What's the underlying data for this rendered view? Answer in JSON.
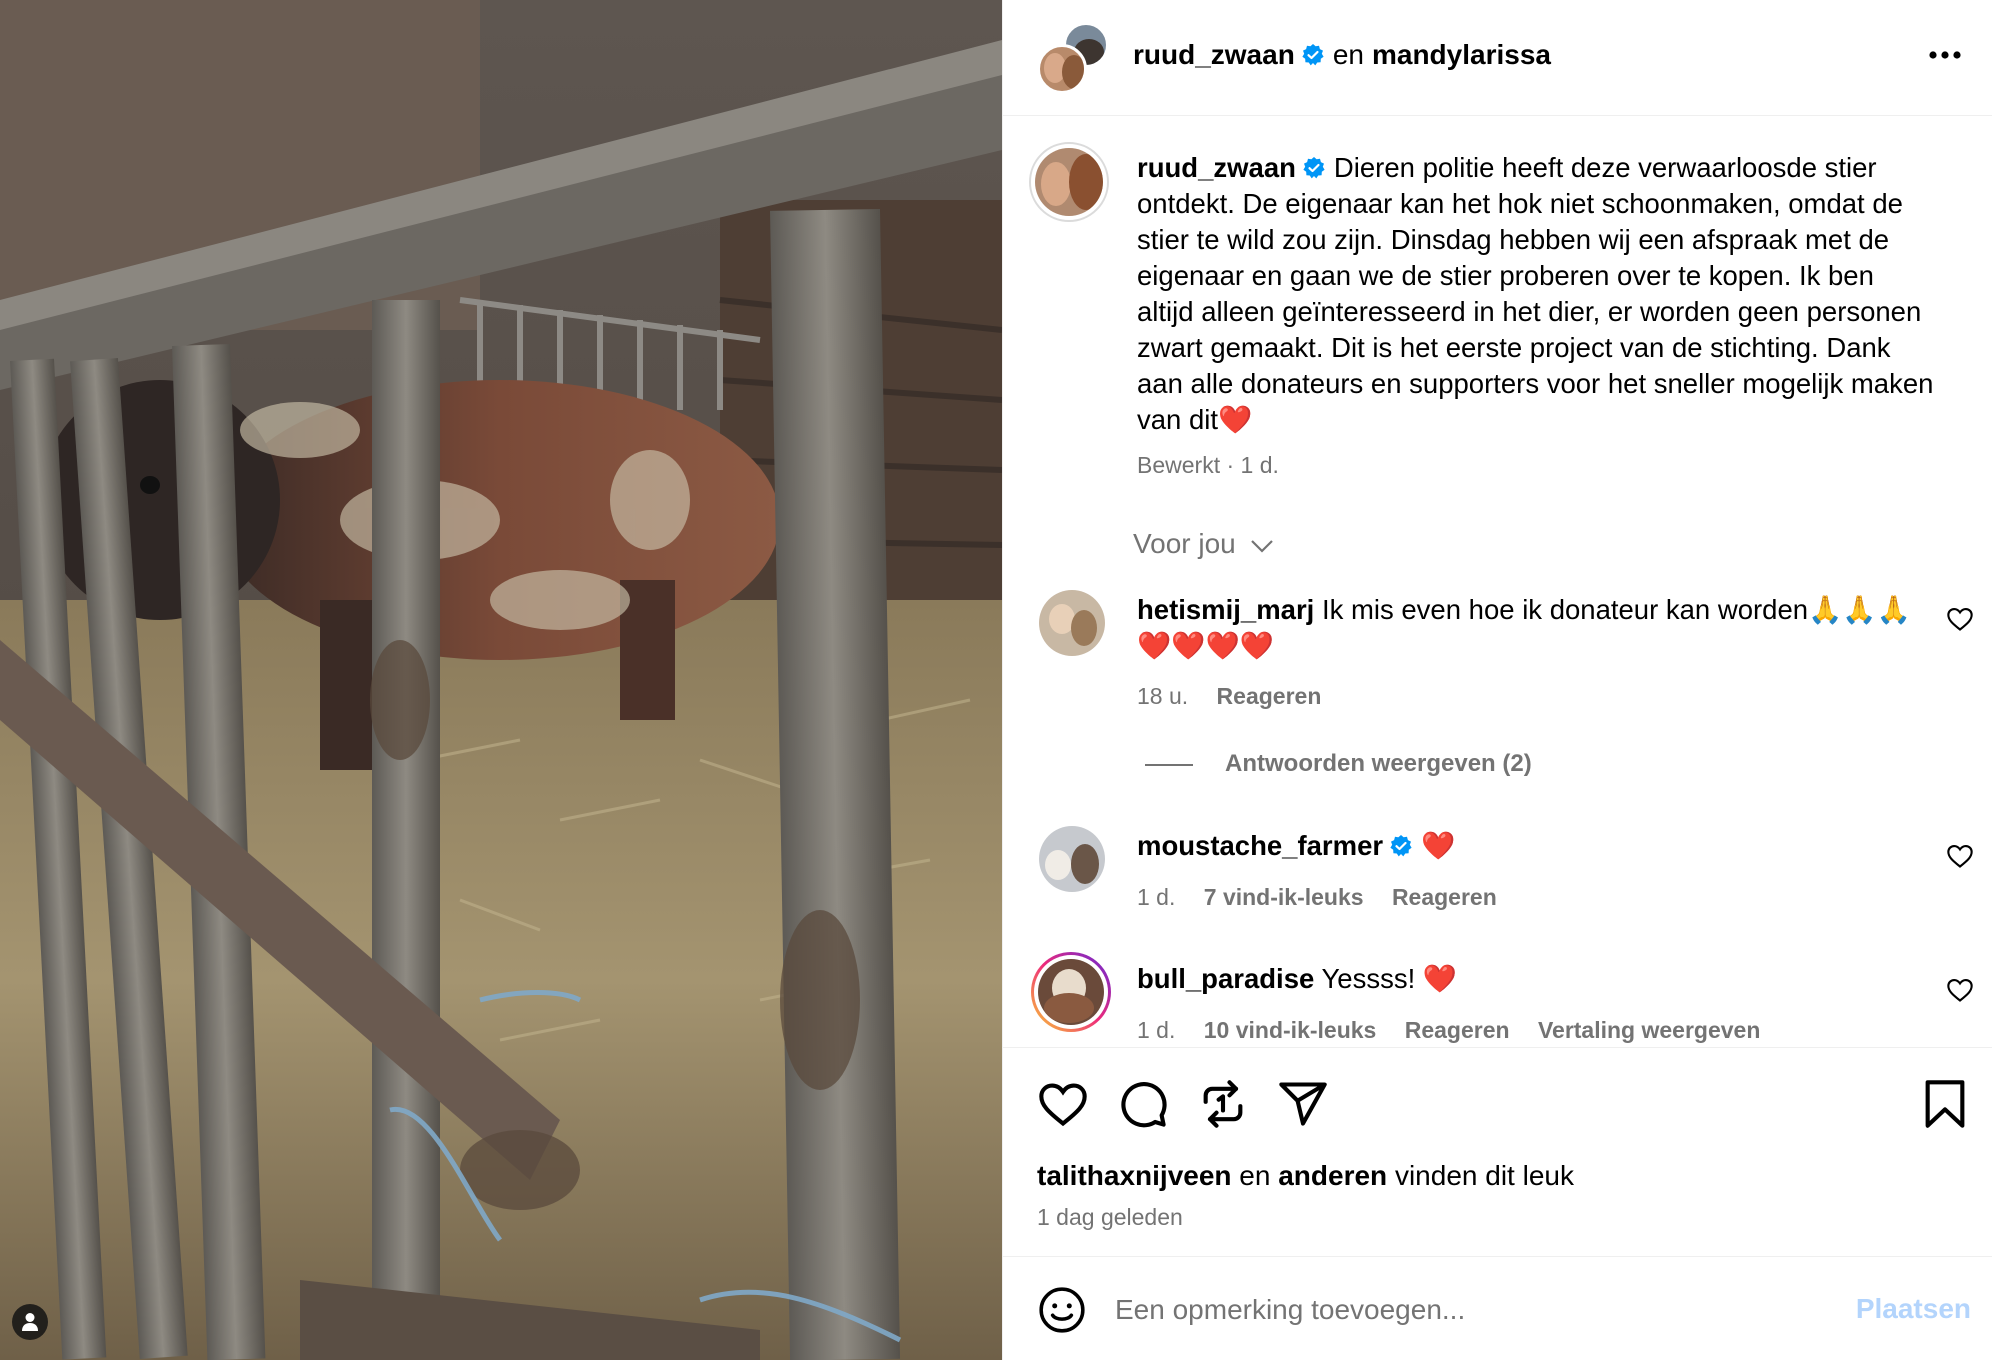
{
  "post": {
    "author": "ruud_zwaan",
    "connector": "en",
    "coauthor": "mandylarissa",
    "caption": "Dieren politie heeft deze verwaarloosde stier ontdekt. De eigenaar kan het hok niet schoonmaken, omdat de stier te wild zou zijn. Dinsdag hebben wij een afspraak met de eigenaar en gaan we de stier proberen over te kopen. Ik ben altijd alleen geïnteresseerd in het dier, er worden geen personen zwart gemaakt. Dit is het eerste project van de stichting. Dank aan alle donateurs en supporters voor het sneller mogelijk maken van dit❤️",
    "caption_meta": "Bewerkt · 1 d.",
    "filter_label": "Voor jou"
  },
  "comments": [
    {
      "username": "hetismij_marj",
      "text": "Ik mis even hoe ik donateur kan worden🙏🙏🙏❤️❤️❤️❤️",
      "time": "18 u.",
      "reply_label": "Reageren",
      "replies_label": "Antwoorden weergeven (2)"
    },
    {
      "username": "moustache_farmer",
      "text": "❤️",
      "time": "1 d.",
      "likes": "7 vind-ik-leuks",
      "reply_label": "Reageren"
    },
    {
      "username": "bull_paradise",
      "text": "Yessss! ❤️",
      "time": "1 d.",
      "likes": "10 vind-ik-leuks",
      "reply_label": "Reageren",
      "translate_label": "Vertaling weergeven"
    }
  ],
  "likes_line": {
    "user": "talithaxnijveen",
    "connector": "en",
    "others": "anderen",
    "suffix": "vinden dit leuk"
  },
  "time_ago": "1 dag geleden",
  "comment_box": {
    "placeholder": "Een opmerking toevoegen...",
    "post_label": "Plaatsen"
  },
  "icons": {
    "header": [
      "verified-badge",
      "more-options-icon"
    ],
    "actions": [
      "heart-icon",
      "comment-icon",
      "repost-icon",
      "share-icon",
      "bookmark-icon"
    ],
    "comment_bar": [
      "emoji-icon"
    ]
  },
  "colors": {
    "verified": "#0095f6",
    "muted_text": "#737373",
    "post_button_disabled": "#b3d4fc",
    "story_ring_start": "#f9ce34",
    "story_ring_end": "#c13584"
  }
}
